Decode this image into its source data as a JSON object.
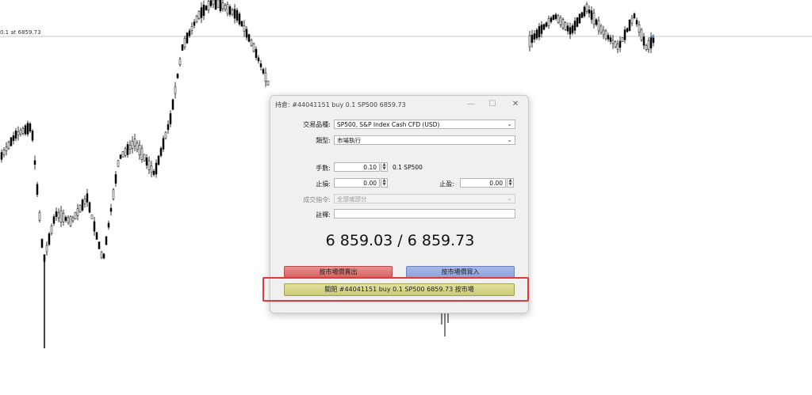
{
  "chart": {
    "price_line_label": "0.1 at 6859.73"
  },
  "dialog": {
    "title": "持倉: #44041151 buy 0.1 SP500 6859.73",
    "symbol_label": "交易品種:",
    "symbol_value": "SP500, S&P Index Cash CFD (USD)",
    "type_label": "類型:",
    "type_value": "市場執行",
    "volume_label": "手數:",
    "volume_value": "0.10",
    "volume_unit": "0.1 SP500",
    "stop_loss_label": "止損:",
    "stop_loss_value": "0.00",
    "take_profit_label": "止盈:",
    "take_profit_value": "0.00",
    "fill_policy_label": "成交指令:",
    "fill_policy_value": "全部或部分",
    "comment_label": "註釋:",
    "comment_value": "",
    "price_display": "6 859.03 / 6 859.73",
    "sell_button": "按市場價賣出",
    "buy_button": "按市場價買入",
    "close_button": "關閉 #44041151 buy 0.1 SP500 6859.73 按市場"
  },
  "colors": {
    "sell": "#d76666",
    "buy": "#8ea3dd",
    "close": "#c9c976",
    "highlight": "#e0393c"
  }
}
